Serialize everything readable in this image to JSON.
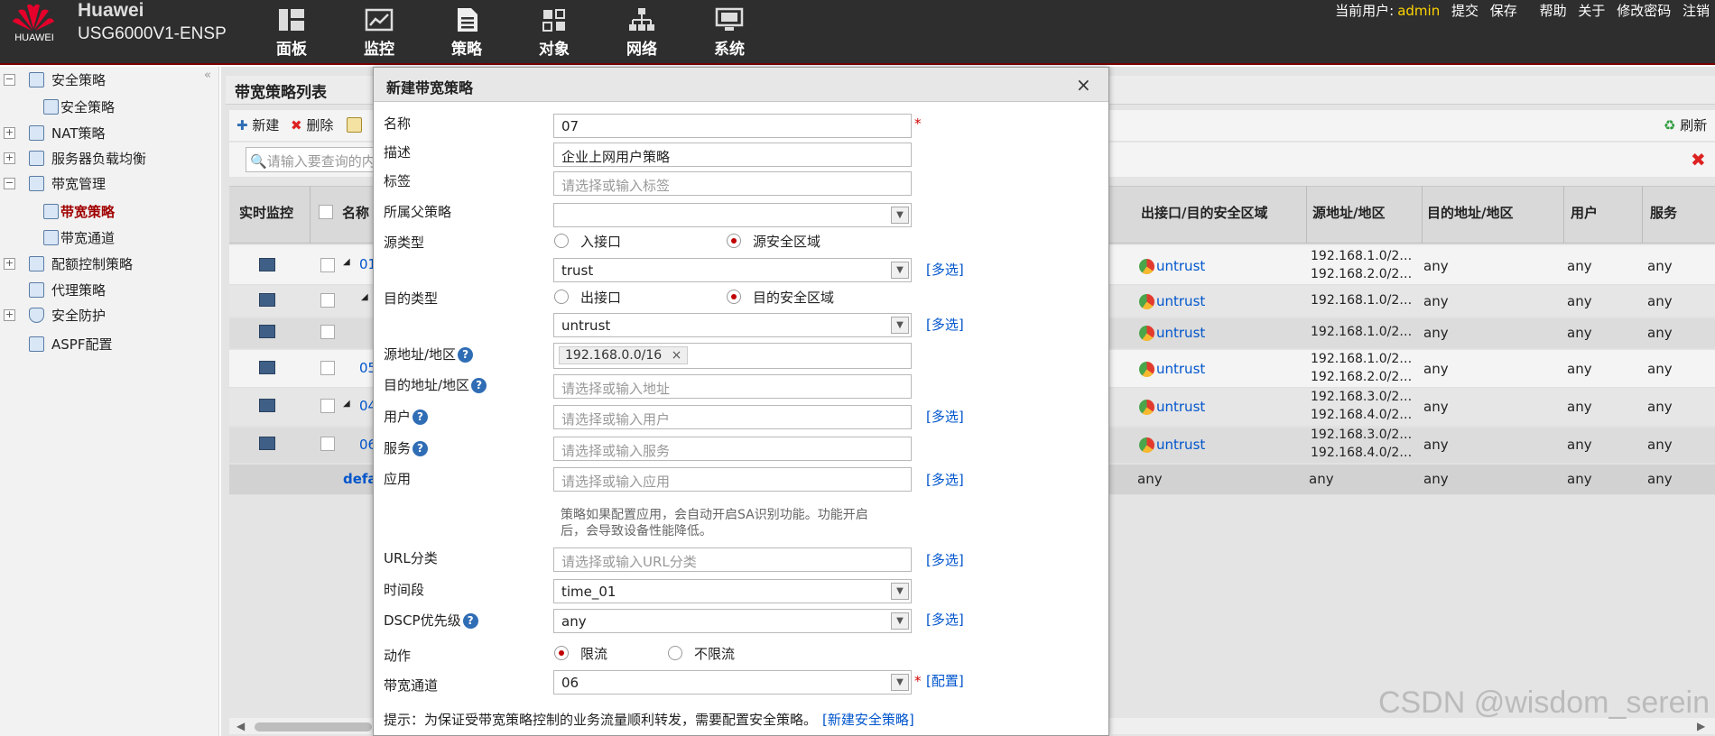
{
  "app": {
    "brand": "Huawei",
    "model": "USG6000V1-ENSP",
    "logo_text": "HUAWEI"
  },
  "nav": [
    {
      "label": "面板",
      "icon": "dashboard-icon"
    },
    {
      "label": "监控",
      "icon": "monitor-chart-icon"
    },
    {
      "label": "策略",
      "icon": "document-icon"
    },
    {
      "label": "对象",
      "icon": "objects-icon"
    },
    {
      "label": "网络",
      "icon": "network-icon"
    },
    {
      "label": "系统",
      "icon": "system-monitor-icon"
    }
  ],
  "userbar": {
    "prefix": "当前用户:",
    "user": "admin",
    "commit": "提交",
    "save": "保存",
    "help": "帮助",
    "about": "关于",
    "change_pw": "修改密码",
    "logout": "注销"
  },
  "sidebar": [
    "安全策略",
    "安全策略",
    "NAT策略",
    "服务器负载均衡",
    "带宽管理",
    "带宽策略",
    "带宽通道",
    "配额控制策略",
    "代理策略",
    "安全防护",
    "ASPF配置"
  ],
  "panel": {
    "title": "带宽策略列表",
    "new": "新建",
    "delete": "删除",
    "refresh": "刷新",
    "search_placeholder": "请输入要查询的内"
  },
  "grid": {
    "headers": {
      "monitor": "实时监控",
      "name": "名称",
      "egress": "出接口/目的安全区域",
      "src": "源地址/地区",
      "dst": "目的地址/地区",
      "user": "用户",
      "service": "服务"
    },
    "rows": [
      {
        "name": "01",
        "egress": "untrust",
        "src1": "192.168.1.0/2…",
        "src2": "192.168.2.0/2…",
        "dst": "any",
        "user": "any",
        "service": "any"
      },
      {
        "name": "",
        "egress": "untrust",
        "src1": "192.168.1.0/2…",
        "src2": "",
        "dst": "any",
        "user": "any",
        "service": "any"
      },
      {
        "name": "",
        "egress": "untrust",
        "src1": "192.168.1.0/2…",
        "src2": "",
        "dst": "any",
        "user": "any",
        "service": "any"
      },
      {
        "name": "05",
        "egress": "untrust",
        "src1": "192.168.1.0/2…",
        "src2": "192.168.2.0/2…",
        "dst": "any",
        "user": "any",
        "service": "any"
      },
      {
        "name": "04",
        "egress": "untrust",
        "src1": "192.168.3.0/2…",
        "src2": "192.168.4.0/2…",
        "dst": "any",
        "user": "any",
        "service": "any"
      },
      {
        "name": "06",
        "egress": "untrust",
        "src1": "192.168.3.0/2…",
        "src2": "192.168.4.0/2…",
        "dst": "any",
        "user": "any",
        "service": "any"
      }
    ],
    "default_row": {
      "name": "defa",
      "egress": "any",
      "src": "any",
      "dst": "any",
      "user": "any",
      "service": "any"
    }
  },
  "dialog": {
    "title": "新建带宽策略",
    "close": "×",
    "name_label": "名称",
    "name_value": "07",
    "desc_label": "描述",
    "desc_value": "企业上网用户策略",
    "tag_label": "标签",
    "tag_placeholder": "请选择或输入标签",
    "parent_label": "所属父策略",
    "parent_value": "",
    "src_type_label": "源类型",
    "src_opt_if": "入接口",
    "src_opt_zone": "源安全区域",
    "src_zone_value": "trust",
    "dst_type_label": "目的类型",
    "dst_opt_if": "出接口",
    "dst_opt_zone": "目的安全区域",
    "dst_zone_value": "untrust",
    "src_addr_label": "源地址/地区",
    "src_addr_tag": "192.168.0.0/16",
    "dst_addr_label": "目的地址/地区",
    "dst_addr_placeholder": "请选择或输入地址",
    "user_label": "用户",
    "user_placeholder": "请选择或输入用户",
    "service_label": "服务",
    "service_placeholder": "请选择或输入服务",
    "app_label": "应用",
    "app_placeholder": "请选择或输入应用",
    "app_note_1": "策略如果配置应用，会自动开启SA识别功能。功能开启",
    "app_note_2": "后，会导致设备性能降低。",
    "url_label": "URL分类",
    "url_placeholder": "请选择或输入URL分类",
    "time_label": "时间段",
    "time_value": "time_01",
    "dscp_label": "DSCP优先级",
    "dscp_value": "any",
    "action_label": "动作",
    "action_limit": "限流",
    "action_nolimit": "不限流",
    "channel_label": "带宽通道",
    "channel_value": "06",
    "multi": "[多选]",
    "config": "[配置]",
    "hint": "提示：为保证受带宽策略控制的业务流量顺利转发，需要配置安全策略。",
    "hint_link": "[新建安全策略]",
    "req_mark": "*",
    "help_mark": "?",
    "tag_remove": "×"
  },
  "watermark": "CSDN @wisdom_serein",
  "colors": {
    "topbar": "#2e2e2e",
    "accent": "#c00000",
    "link": "#0055cc",
    "user": "#ffd400"
  }
}
